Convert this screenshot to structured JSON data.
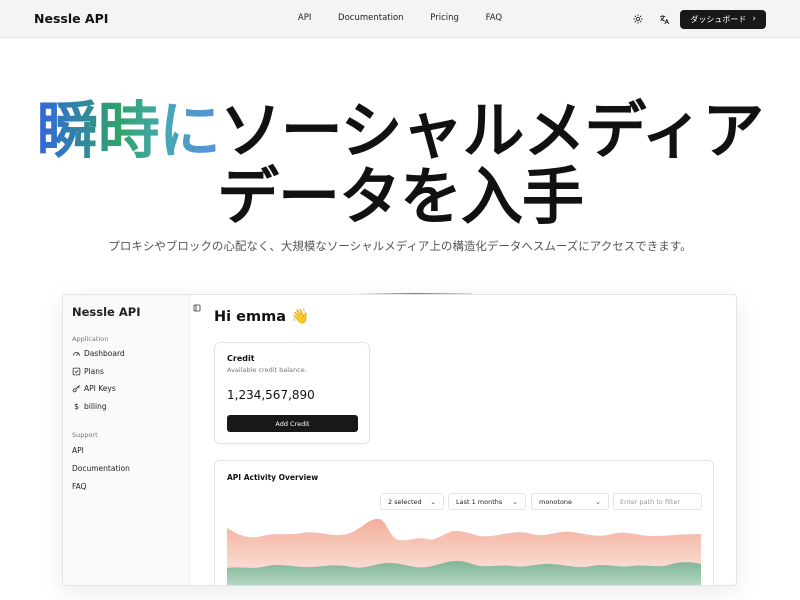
{
  "nav": {
    "brand": "Nessle API",
    "links": [
      "API",
      "Documentation",
      "Pricing",
      "FAQ"
    ],
    "dashboard_label": "ダッシュボード"
  },
  "hero": {
    "title_highlight": "瞬時に",
    "title_rest_line1": "ソーシャルメディア",
    "title_line2": "データを入手",
    "subtitle": "プロキシやブロックの心配なく、大規模なソーシャルメディア上の構造化データへスムーズにアクセスできます。"
  },
  "app": {
    "brand": "Nessle API",
    "sidebar": {
      "application_label": "Application",
      "application_items": [
        {
          "label": "Dashboard",
          "icon": "gauge-icon"
        },
        {
          "label": "Plans",
          "icon": "checkbox-icon"
        },
        {
          "label": "API Keys",
          "icon": "key-icon"
        },
        {
          "label": "billing",
          "icon": "dollar-icon"
        }
      ],
      "support_label": "Support",
      "support_items": [
        "API",
        "Documentation",
        "FAQ"
      ]
    },
    "greeting": "Hi emma 👋",
    "credit": {
      "title": "Credit",
      "subtitle": "Available credit balance.",
      "value": "1,234,567,890",
      "button": "Add Credit"
    },
    "activity": {
      "title": "API Activity Overview",
      "filters": {
        "selected": "2 selected",
        "range": "Last 1 months",
        "style": "monotone",
        "path_placeholder": "Enter path to filter"
      },
      "colors": {
        "series_a": "#f4b9a8",
        "series_b": "#8fbfa6"
      }
    }
  }
}
